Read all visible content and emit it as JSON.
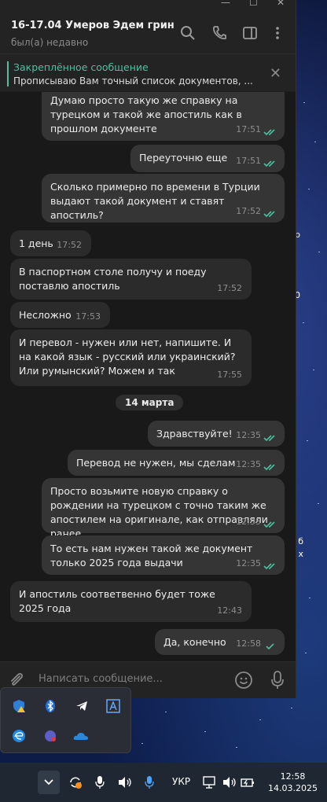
{
  "window": {
    "controls": [
      "—",
      "☐",
      "✕"
    ]
  },
  "header": {
    "title": "16-17.04 Умеров Эдем грин",
    "status": "был(а) недавно",
    "icons": [
      "search-icon",
      "phone-icon",
      "sidebar-icon",
      "more-icon"
    ]
  },
  "pinned": {
    "title": "Закреплённое сообщение",
    "text": "Прописываю Вам точный список документов, ...",
    "close": "✕"
  },
  "messages": [
    {
      "dir": "out",
      "text": "Думаю просто такую же справку на турецком и такой же апостиль как в прошлом документе",
      "time": "17:51",
      "read": true
    },
    {
      "dir": "out",
      "text": "Переуточню еще",
      "time": "17:51",
      "read": true
    },
    {
      "dir": "out",
      "text": "Сколько примерно по времени в Турции выдают такой документ и ставят апостиль?",
      "time": "17:52",
      "read": true
    },
    {
      "dir": "in",
      "text": "1 день",
      "time": "17:52"
    },
    {
      "dir": "in",
      "text": "В паспортном столе получу и поеду поставлю апостиль",
      "time": "17:52"
    },
    {
      "dir": "in",
      "text": "Несложно",
      "time": "17:53"
    },
    {
      "dir": "in",
      "text": "И перевол - нужен или нет, напишите. И на какой язык - русский или украинский? Или румынский? Можем и так",
      "time": "17:55"
    },
    {
      "dir": "out",
      "text": "Здравствуйте!",
      "time": "12:35",
      "read": true
    },
    {
      "dir": "out",
      "text": "Перевод не нужен, мы сделам",
      "time": "12:35",
      "read": true
    },
    {
      "dir": "out",
      "text": "Просто возьмите новую справку о рождении на турецком с точно таким же апостилем на оригинале, как отправляли ранее",
      "time": "12:35",
      "read": true
    },
    {
      "dir": "out",
      "text": "То есть нам нужен такой же документ только 2025 года выдачи",
      "time": "12:35",
      "read": true
    },
    {
      "dir": "in",
      "text": "И апостиль соответвенно будет тоже 2025 года",
      "time": "12:43"
    },
    {
      "dir": "out",
      "text": "Да, конечно",
      "time": "12:58",
      "read": false
    }
  ],
  "date_separator": "14 марта",
  "composer": {
    "placeholder": "Написать сообщение..."
  },
  "desktop_labels": [
    "р",
    "0",
    "б",
    "х"
  ],
  "tray_popup": {
    "icons": [
      "defender-warning-icon",
      "bluetooth-icon",
      "telegram-icon",
      "text-input-icon",
      "edge-icon",
      "teams-icon",
      "onedrive-icon"
    ]
  },
  "taskbar": {
    "language": "УКР",
    "time": "12:58",
    "date": "14.03.2025"
  },
  "colors": {
    "accent": "#4fbfa0",
    "bubble_in": "#2b2b2b",
    "bubble_out": "#353535",
    "chat_bg": "#191919"
  }
}
